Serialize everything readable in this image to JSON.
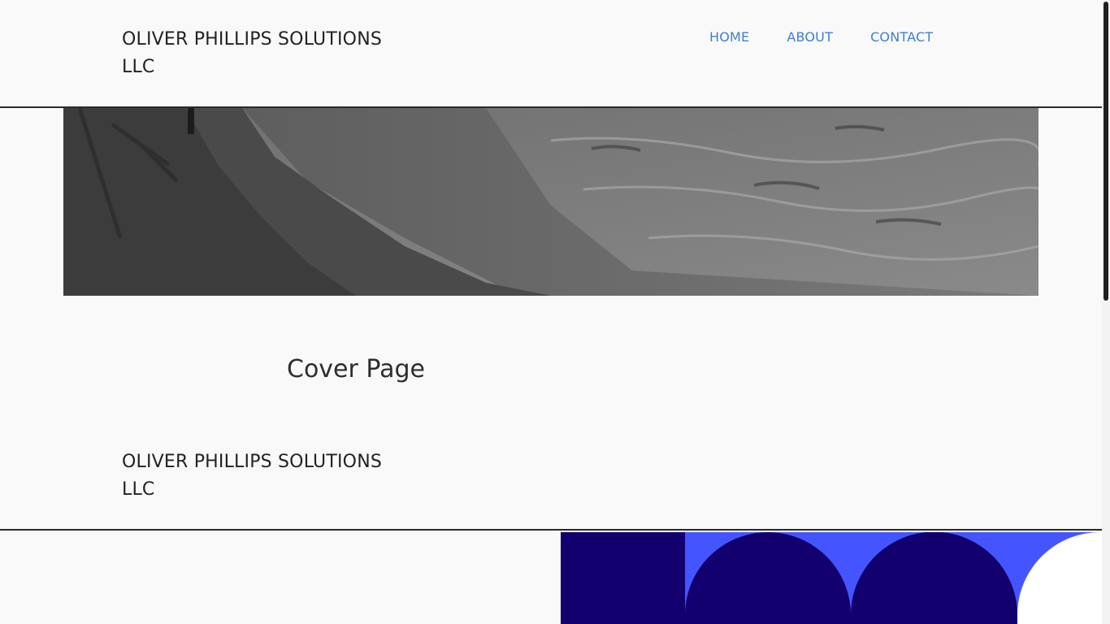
{
  "header": {
    "site_title": "OLIVER PHILLIPS SOLUTIONS LLC",
    "nav": {
      "home": "HOME",
      "about": "ABOUT",
      "contact": "CONTACT"
    }
  },
  "main": {
    "cover_title": "Cover Page"
  },
  "footer": {
    "brand_title": "OLIVER PHILLIPS SOLUTIONS LLC"
  },
  "colors": {
    "nav_link": "#3f7fd0",
    "text": "#222222",
    "deco_dark": "#12006e",
    "deco_bright": "#4455ff",
    "background": "#f9f9f9"
  }
}
